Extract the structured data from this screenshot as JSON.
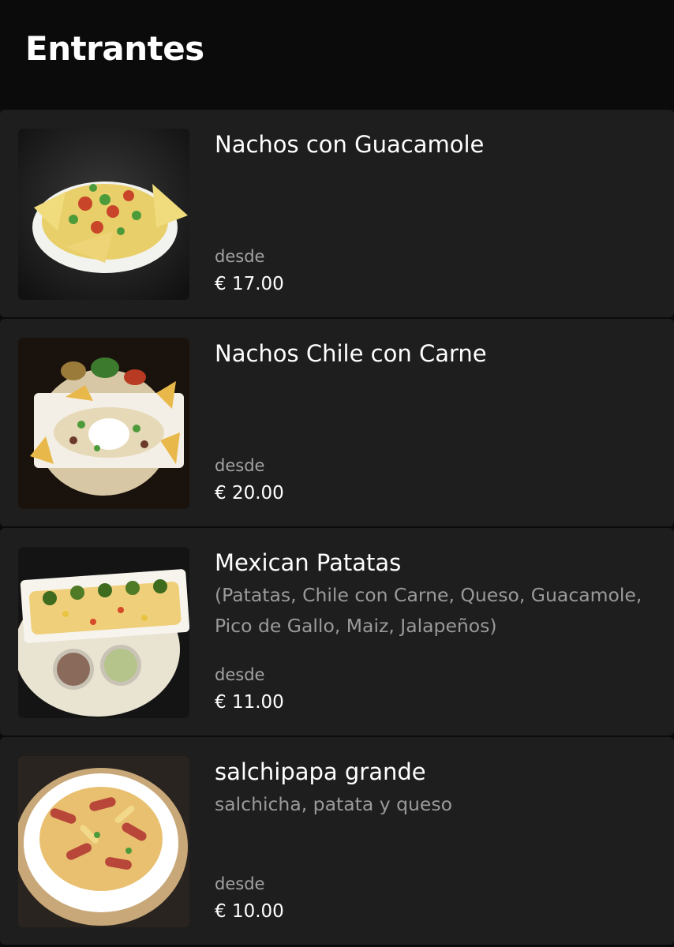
{
  "section": {
    "title": "Entrantes"
  },
  "items": [
    {
      "name": "Nachos con Guacamole",
      "description": "",
      "from_label": "desde",
      "price": "€ 17.00",
      "image": "nachos-guacamole-photo"
    },
    {
      "name": "Nachos Chile con Carne",
      "description": "",
      "from_label": "desde",
      "price": "€ 20.00",
      "image": "nachos-chile-photo"
    },
    {
      "name": "Mexican Patatas",
      "description": "(Patatas, Chile con Carne, Queso, Guacamole, Pico de Gallo, Maiz, Jalapeños)",
      "from_label": "desde",
      "price": "€ 11.00",
      "image": "mexican-patatas-photo"
    },
    {
      "name": "salchipapa grande",
      "description": "salchicha, patata y queso",
      "from_label": "desde",
      "price": "€ 10.00",
      "image": "salchipapa-photo"
    }
  ],
  "colors": {
    "background": "#0b0b0b",
    "card": "#1e1e1e",
    "text_primary": "#ffffff",
    "text_secondary": "#9a9a9a"
  }
}
